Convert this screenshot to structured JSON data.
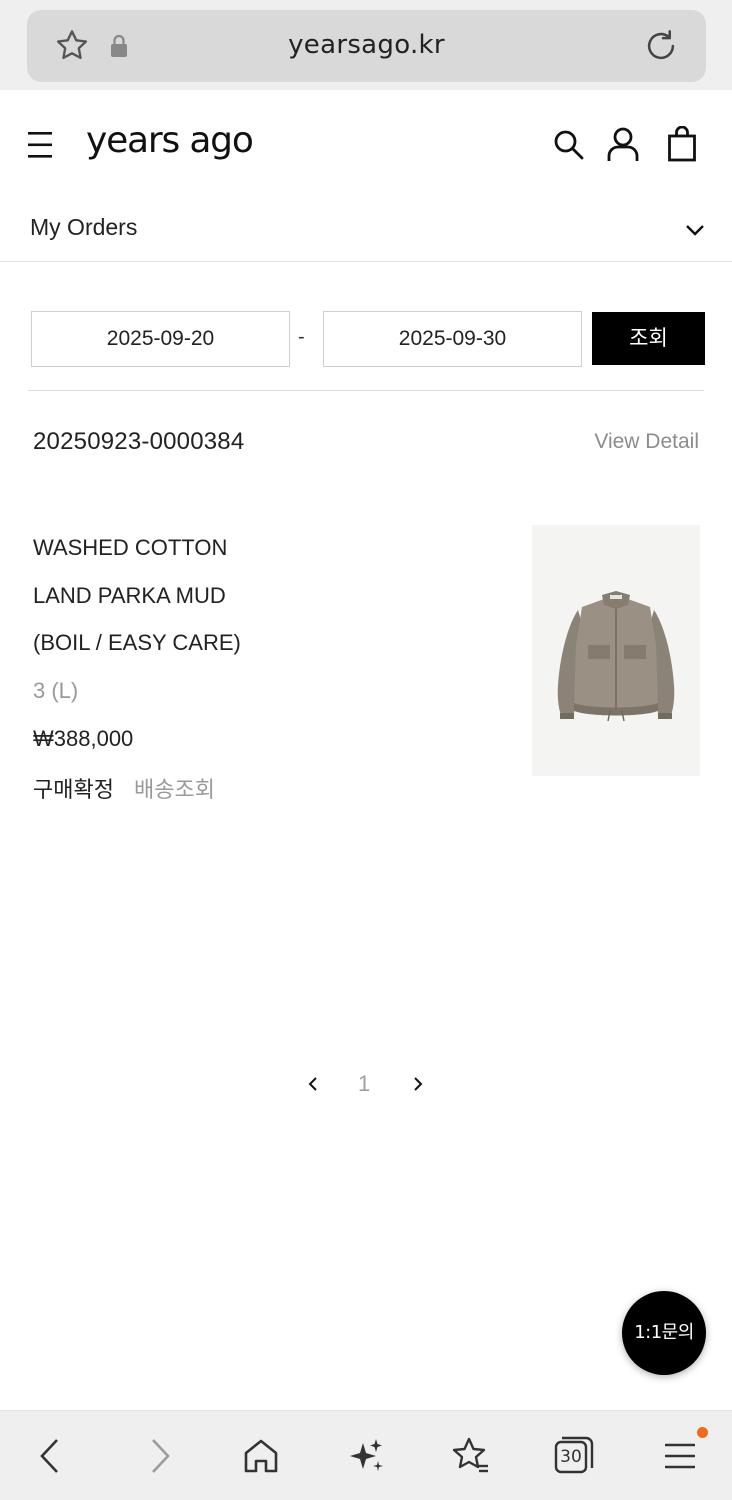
{
  "browser": {
    "url": "yearsago.kr",
    "tab_count": "30"
  },
  "header": {
    "logo": "years ago"
  },
  "orders_menu": {
    "label": "My Orders"
  },
  "filter": {
    "start_date": "2025-09-20",
    "separator": "-",
    "end_date": "2025-09-30",
    "search_label": "조회"
  },
  "order": {
    "number": "20250923-0000384",
    "view_detail": "View Detail",
    "product": {
      "name_lines": [
        "WASHED COTTON",
        "LAND PARKA MUD",
        "(BOIL / EASY CARE)"
      ],
      "option": "3 (L)",
      "price": "₩388,000",
      "status_confirm": "구매확정",
      "status_track": "배송조회"
    }
  },
  "pagination": {
    "current": "1"
  },
  "chat": {
    "label": "1:1문의"
  },
  "colors": {
    "accent": "#000000",
    "notification": "#f26a1b",
    "muted_text": "#8c8c8c"
  },
  "icons": {
    "browser_top": [
      "star-icon",
      "lock-icon",
      "reload-icon"
    ],
    "header": [
      "menu-icon",
      "search-icon",
      "user-icon",
      "bag-icon"
    ],
    "bottom_nav": [
      "back-icon",
      "forward-icon",
      "home-icon",
      "sparkle-icon",
      "favorites-icon",
      "tabs-icon",
      "menu-icon"
    ]
  }
}
